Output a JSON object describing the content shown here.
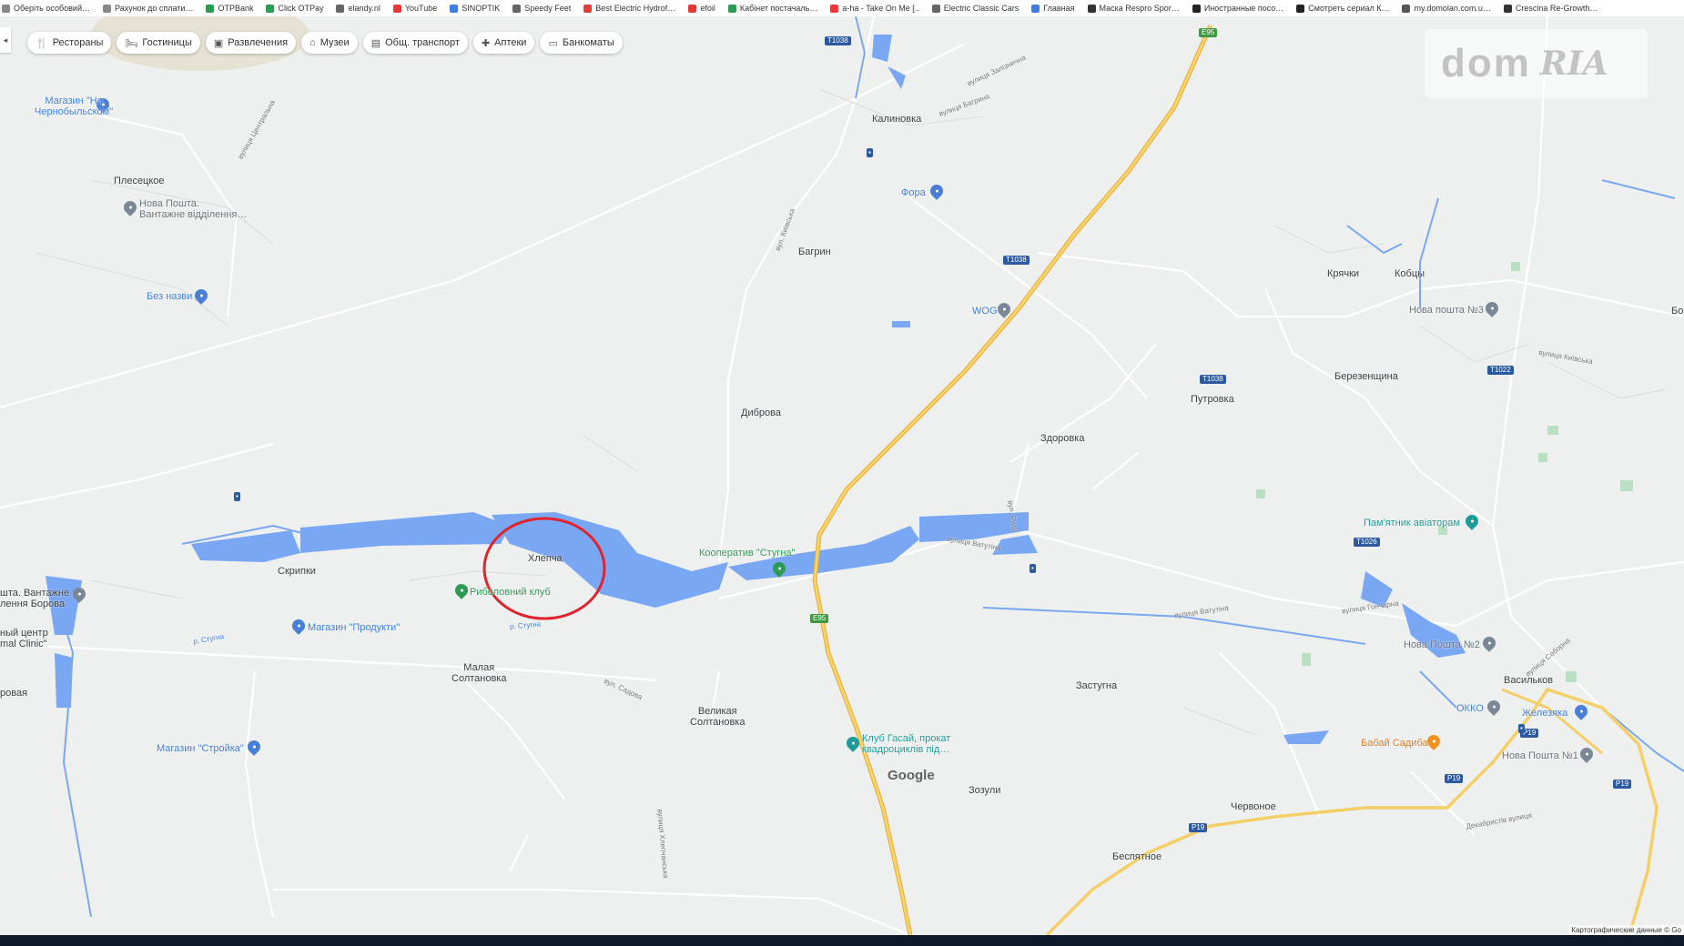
{
  "bookmarks": [
    {
      "label": "Оберіть особовий…",
      "icon": "bookmark-icon",
      "color": "#888888"
    },
    {
      "label": "Рахунок до сплати…",
      "icon": "bookmark-icon",
      "color": "#888888"
    },
    {
      "label": "OTPBank",
      "icon": "bank-icon",
      "color": "#2e9b54"
    },
    {
      "label": "Click OTPay",
      "icon": "bank-icon",
      "color": "#2e9b54"
    },
    {
      "label": "elandy.nl",
      "icon": "globe-icon",
      "color": "#666666"
    },
    {
      "label": "YouTube",
      "icon": "youtube-icon",
      "color": "#e53935"
    },
    {
      "label": "SINOPTIK",
      "icon": "weather-icon",
      "color": "#3d7ee0"
    },
    {
      "label": "Speedy Feet",
      "icon": "globe-icon",
      "color": "#666666"
    },
    {
      "label": "Best Electric Hydrof…",
      "icon": "youtube-icon",
      "color": "#e53935"
    },
    {
      "label": "efoil",
      "icon": "youtube-icon",
      "color": "#e53935"
    },
    {
      "label": "Кабінет постачаль…",
      "icon": "doc-icon",
      "color": "#2e9b54"
    },
    {
      "label": "a-ha - Take On Me [..",
      "icon": "youtube-icon",
      "color": "#e53935"
    },
    {
      "label": "Electric Classic Cars",
      "icon": "globe-icon",
      "color": "#666666"
    },
    {
      "label": "Главная",
      "icon": "globe-icon",
      "color": "#3d7ee0"
    },
    {
      "label": "Маска Respro Spor…",
      "icon": "globe-icon",
      "color": "#333333"
    },
    {
      "label": "Иностранные посо…",
      "icon": "globe-icon",
      "color": "#222222"
    },
    {
      "label": "Смотреть сериал К…",
      "icon": "hd-icon",
      "color": "#222222"
    },
    {
      "label": "my.domolan.com.u…",
      "icon": "globe-icon",
      "color": "#555555"
    },
    {
      "label": "Crescina Re-Growth…",
      "icon": "globe-icon",
      "color": "#333333"
    }
  ],
  "collapse_glyph": "◂",
  "chips": [
    {
      "label": "Рестораны",
      "icon": "fork-knife-icon",
      "glyph": "🍴"
    },
    {
      "label": "Гостиницы",
      "icon": "bed-icon",
      "glyph": "🛏"
    },
    {
      "label": "Развлечения",
      "icon": "camera-icon",
      "glyph": "▣"
    },
    {
      "label": "Музеи",
      "icon": "museum-icon",
      "glyph": "⌂"
    },
    {
      "label": "Общ. транспорт",
      "icon": "bus-icon",
      "glyph": "▤"
    },
    {
      "label": "Аптеки",
      "icon": "pharmacy-icon",
      "glyph": "✚"
    },
    {
      "label": "Банкоматы",
      "icon": "atm-icon",
      "glyph": "▭"
    }
  ],
  "watermark": {
    "left": "dom",
    "right": "RIA"
  },
  "places": {
    "kalinovka": "Калиновка",
    "plesetskoe": "Плесецкое",
    "bagrin": "Багрин",
    "kryachki": "Крячки",
    "kobtsy": "Кобцы",
    "berezenshchina": "Березенщина",
    "putrovka": "Путровка",
    "zdorovka": "Здоровка",
    "dibrova": "Диброва",
    "khlepcha": "Хлепча",
    "skripki": "Скрипки",
    "malaya_soltanovka": "Малая\nСолтановка",
    "velikaya_soltanovka": "Великая\nСолтановка",
    "zastugna": "Застугна",
    "zozuli": "Зозули",
    "chervonoe": "Червоное",
    "bespyatnoe": "Беспятное",
    "vasilkov": "Васильков",
    "borovaya": "ровая",
    "bo_edge": "Бо"
  },
  "pois": {
    "magazin_chernobyl": "Магазин \"На\nЧернобыльском\"",
    "nova_poshta_plesetskoe": "Нова Пошта.\nВантажне відділення…",
    "bez_nazvy": "Без назви",
    "fora": "Фора",
    "wog": "WOG",
    "nova_poshta_3": "Нова пошта №3",
    "pamyatnik": "Пам'ятник авіаторам",
    "kooperativ": "Кооператив \"Стугна\"",
    "ribolovny_klub": "Риболовний клуб",
    "magazin_produkty": "Магазин \"Продукти\"",
    "nova_poshta_borova": "шта. Вантажне\nлення Борова",
    "medical_center": "ный центр\nmal Clinic\"",
    "magazin_stroyka": "Магазин \"Стройка\"",
    "klub_gasai": "Клуб Гасай, прокат\nквадроциклів під…",
    "nova_poshta_2": "Нова Пошта №2",
    "okko": "ОККО",
    "zhelezyaka": "Железяка",
    "babai_sadyba": "Бабай Садиба",
    "nova_poshta_1": "Нова Пошта №1"
  },
  "roads": {
    "t1038_a": "T1038",
    "t1038_b": "T1038",
    "t1038_c": "T1038",
    "t1022": "T1022",
    "t1026": "T1026",
    "e95_a": "E95",
    "e95_b": "E95",
    "r19_a": "P19",
    "r19_b": "P19",
    "r19_c": "P19",
    "r19_d": "P19"
  },
  "streets": {
    "zaliznychna": "вулиця Залізнична",
    "tsentralna": "вулиця Центральна",
    "kyivska": "вул. Київська",
    "bagrina": "вулиця Багрина",
    "ruda": "вул. Руда",
    "stugna_river": "р. Стугна",
    "vatutina": "вулиця Ватутіна",
    "goncharna": "вулиця Гончарна",
    "sadova": "вул. Садова",
    "khlepchska": "вулиця Хлепчанська",
    "kyivska_e": "вулиця Київська",
    "soborna": "вулиця Соборна",
    "dekabrystiv": "Декабристів вулиця"
  },
  "google_logo": "Google",
  "attribution": "Картографические данные © Go",
  "colors": {
    "water": "#7aa7f3",
    "motorway": "#f5c443",
    "road": "#ffffff",
    "map_bg": "#eef0ef",
    "highlight_circle": "#e0232c",
    "poi_blue": "#4a7fd8",
    "poi_green": "#2e9b54",
    "poi_teal": "#1d9b9b",
    "poi_orange": "#f0921d"
  }
}
